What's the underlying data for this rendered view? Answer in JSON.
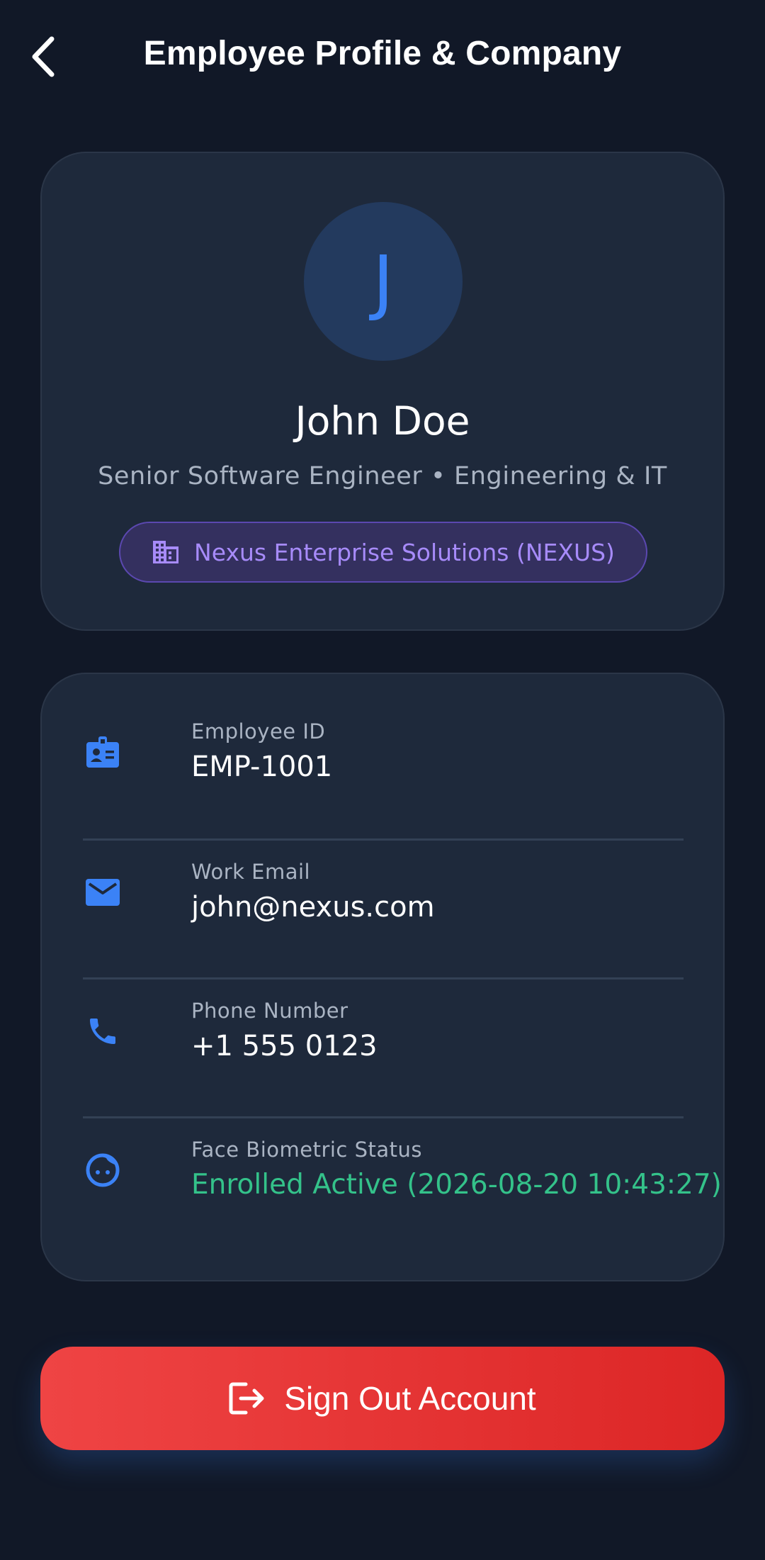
{
  "header": {
    "title": "Employee Profile & Company",
    "back_icon": "chevron-left-icon"
  },
  "profile": {
    "avatar_initial": "J",
    "name": "John Doe",
    "role": "Senior Software Engineer • Engineering & IT",
    "company": "Nexus Enterprise Solutions (NEXUS)",
    "company_icon": "building-icon"
  },
  "details": [
    {
      "icon": "id-badge-icon",
      "label": "Employee ID",
      "value": "EMP-1001"
    },
    {
      "icon": "email-icon",
      "label": "Work Email",
      "value": "john@nexus.com"
    },
    {
      "icon": "phone-icon",
      "label": "Phone Number",
      "value": "+1 555 0123"
    },
    {
      "icon": "face-icon",
      "label": "Face Biometric Status",
      "value": "Enrolled Active (2026-08-20 10:43:27)",
      "status_color": "#34c28a"
    }
  ],
  "signout": {
    "label": "Sign Out Account",
    "icon": "logout-icon"
  },
  "colors": {
    "background": "#111827",
    "card": "#1e293b",
    "accent": "#3b82f6",
    "company_accent": "#a78bfa",
    "danger": "#ef4444",
    "success": "#34c28a"
  }
}
